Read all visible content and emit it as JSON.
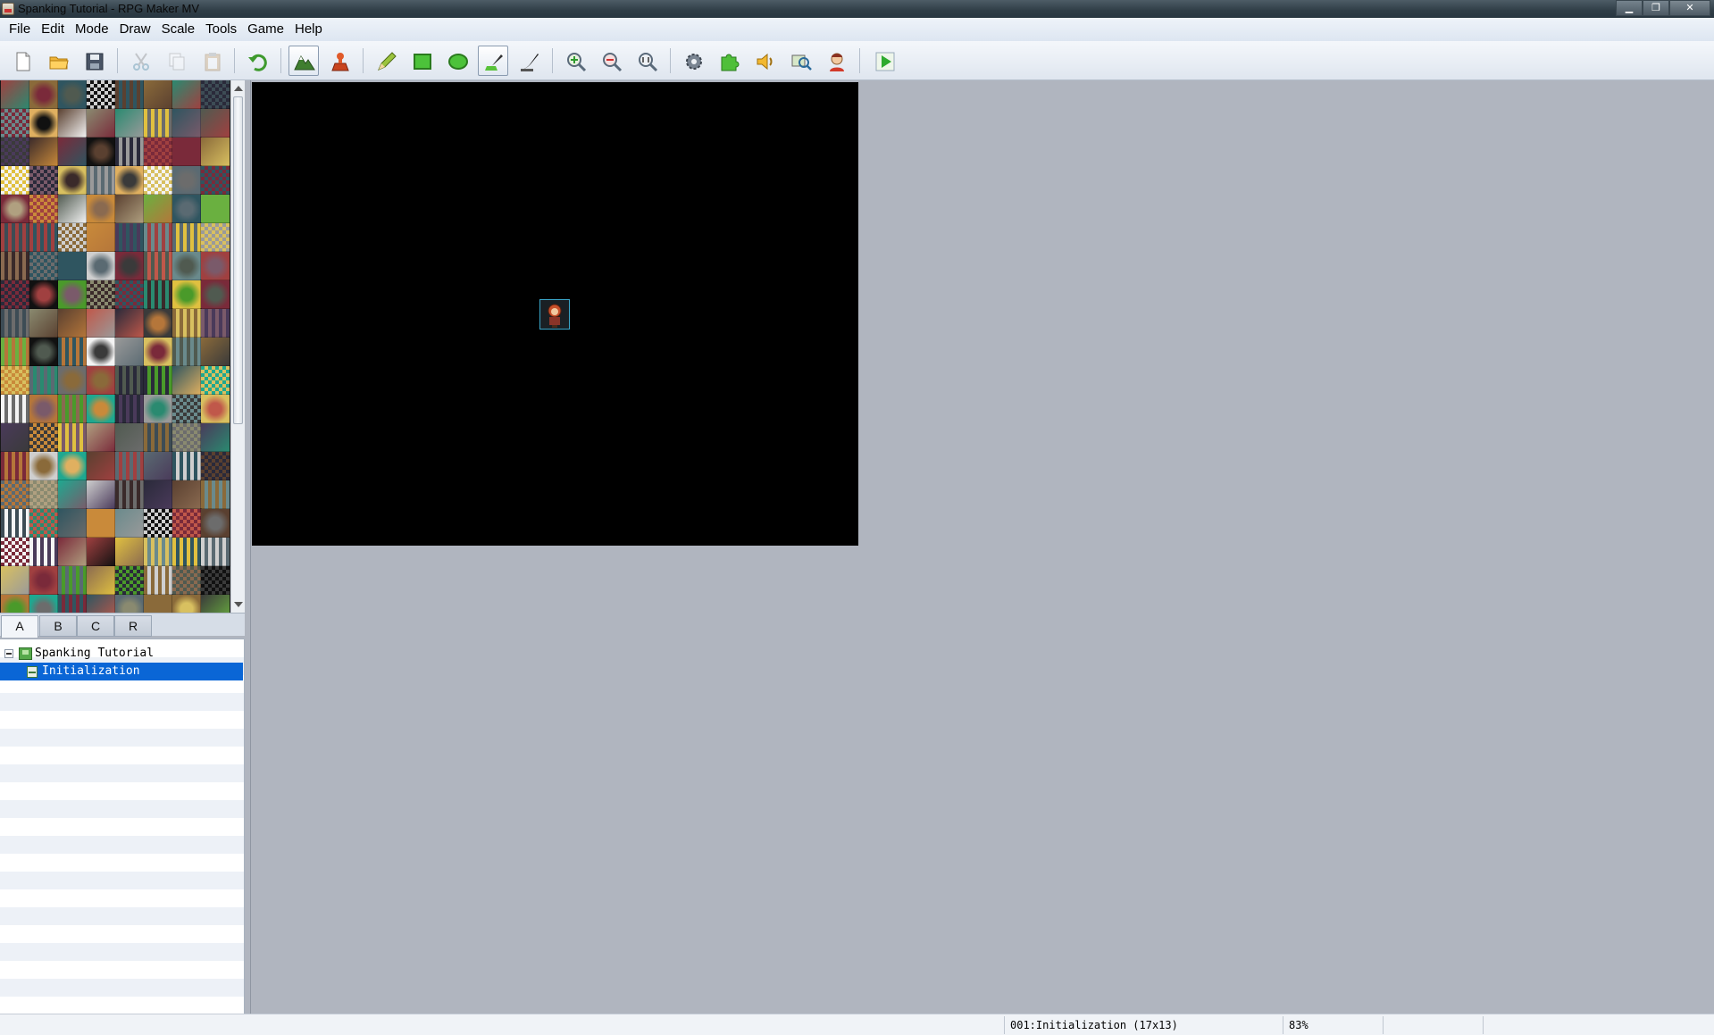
{
  "window": {
    "title": "Spanking Tutorial - RPG Maker MV",
    "minimize": "▁",
    "maximize": "❐",
    "close": "✕"
  },
  "menu": [
    "File",
    "Edit",
    "Mode",
    "Draw",
    "Scale",
    "Tools",
    "Game",
    "Help"
  ],
  "toolbar": {
    "groups": [
      [
        "new-project",
        "open-project",
        "save-project"
      ],
      [
        "cut",
        "copy",
        "paste"
      ],
      [
        "undo"
      ],
      [
        "map-mode",
        "event-mode"
      ],
      [
        "pencil",
        "rectangle",
        "ellipse",
        "flood-fill",
        "shadow-pen"
      ],
      [
        "zoom-in",
        "zoom-out",
        "actual-size"
      ],
      [
        "database",
        "plugin-manager",
        "sound-test",
        "event-searcher",
        "character-generator"
      ],
      [
        "playtest"
      ]
    ]
  },
  "palette": {
    "tabs": [
      "A",
      "B",
      "C",
      "R"
    ],
    "active_tab": "A"
  },
  "map_tree": {
    "project": "Spanking Tutorial",
    "maps": [
      "Initialization"
    ],
    "selected": "Initialization"
  },
  "status": {
    "map": "001:Initialization (17x13)",
    "zoom": "83%"
  },
  "colors": {
    "selection": "#0a66d6",
    "map_background": "#000000",
    "workspace": "#b0b5bf"
  }
}
